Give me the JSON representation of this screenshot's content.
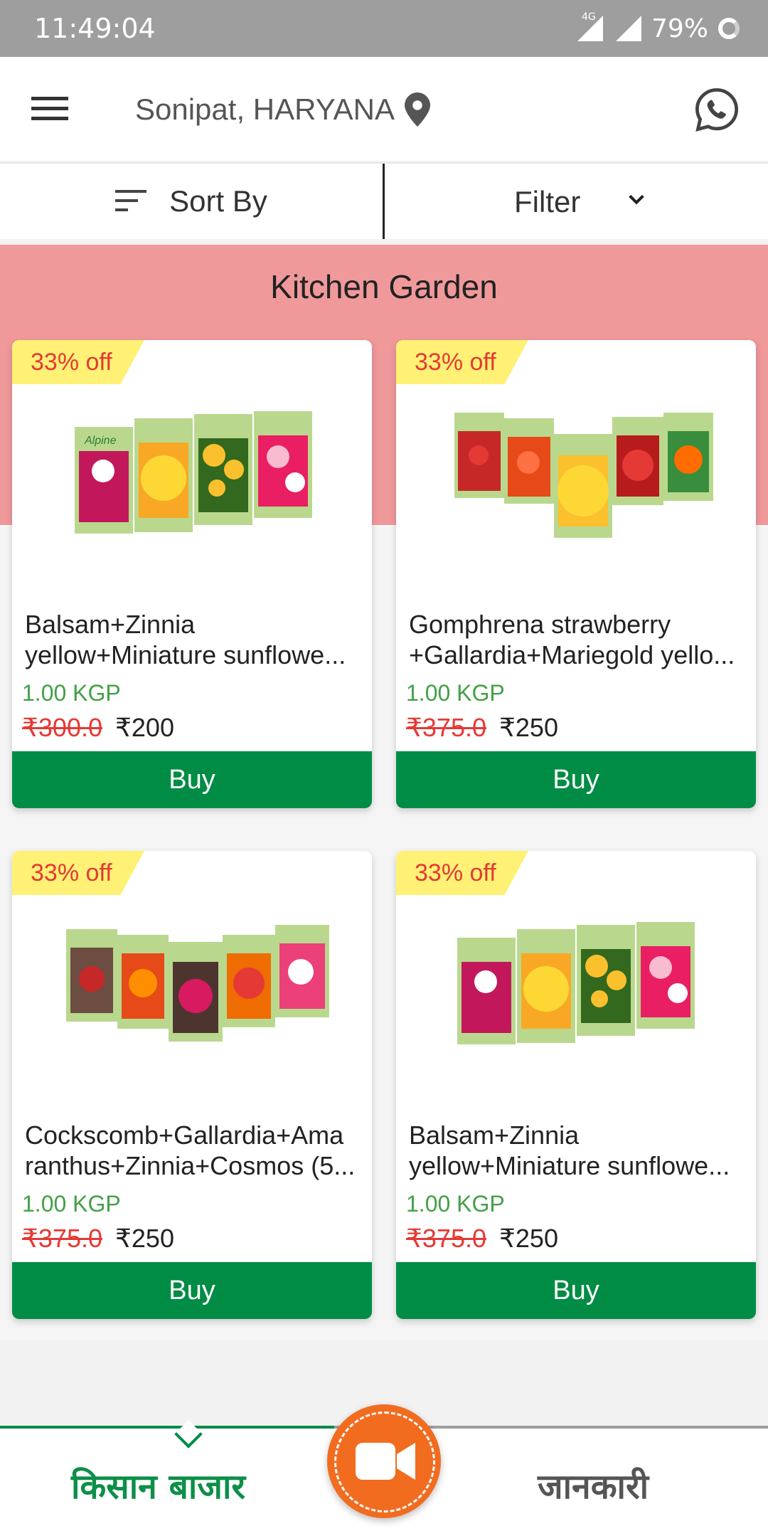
{
  "status_bar": {
    "time": "11:49:04",
    "network": "4G",
    "battery": "79%"
  },
  "header": {
    "location": "Sonipat, HARYANA"
  },
  "toolbar": {
    "sort_label": "Sort By",
    "filter_label": "Filter"
  },
  "section": {
    "title": "Kitchen Garden"
  },
  "products": [
    {
      "badge": "33% off",
      "name_line1": "Balsam+Zinnia",
      "name_line2": "yellow+Miniature sunflowe...",
      "qty": "1.00 KGP",
      "old_price": "₹300.0",
      "new_price": "₹200",
      "buy_label": "Buy"
    },
    {
      "badge": "33% off",
      "name_line1": "Gomphrena strawberry",
      "name_line2": "+Gallardia+Mariegold yello...",
      "qty": "1.00 KGP",
      "old_price": "₹375.0",
      "new_price": "₹250",
      "buy_label": "Buy"
    },
    {
      "badge": "33% off",
      "name_line1": "Cockscomb+Gallardia+Ama",
      "name_line2": "ranthus+Zinnia+Cosmos (5...",
      "qty": "1.00 KGP",
      "old_price": "₹375.0",
      "new_price": "₹250",
      "buy_label": "Buy"
    },
    {
      "badge": "33% off",
      "name_line1": "Balsam+Zinnia",
      "name_line2": "yellow+Miniature sunflowe...",
      "qty": "1.00 KGP",
      "old_price": "₹375.0",
      "new_price": "₹250",
      "buy_label": "Buy"
    }
  ],
  "seed_packet_brand": "Alpine",
  "bottom_nav": {
    "left_tab": "किसान बाजार",
    "right_tab": "जानकारी"
  },
  "colors": {
    "accent_green": "#008c45",
    "band_pink": "#f0999b",
    "fab_orange": "#f26c1f",
    "discount_red": "#e53935",
    "badge_yellow": "#fff176"
  },
  "icons": [
    "menu-icon",
    "location-pin-icon",
    "whatsapp-icon",
    "sort-icon",
    "chevron-down-icon",
    "video-camera-icon"
  ]
}
